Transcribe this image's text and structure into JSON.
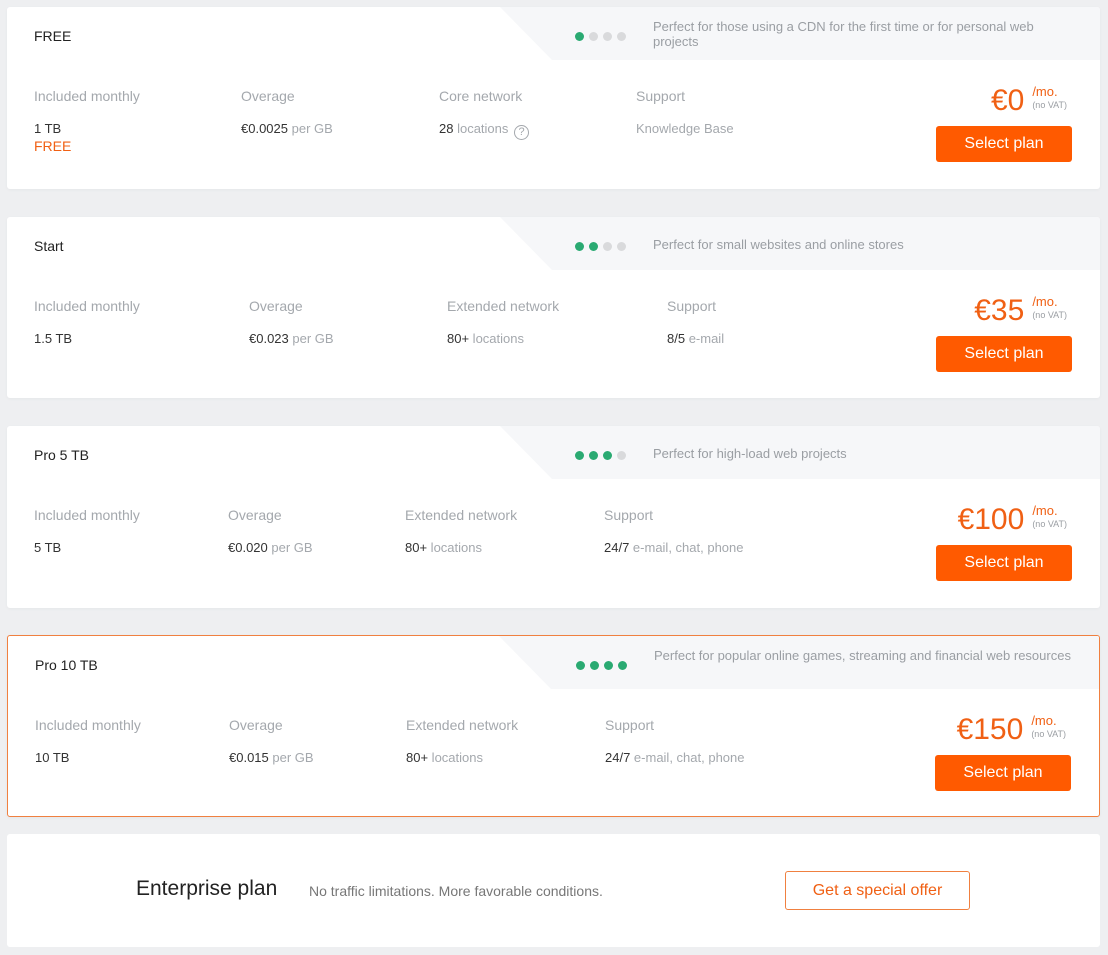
{
  "plans": [
    {
      "name": "FREE",
      "rating": 1,
      "rating_max": 4,
      "description": "Perfect for those using a CDN for the first time or for personal web projects",
      "columns": [
        {
          "label": "Included monthly",
          "value": "1 TB",
          "suffix": "",
          "extra": "FREE"
        },
        {
          "label": "Overage",
          "value": "€0.0025",
          "suffix": " per GB"
        },
        {
          "label": "Core network",
          "value": "28",
          "suffix": " locations",
          "help": "?"
        },
        {
          "label": "Support",
          "value": "",
          "suffix": "Knowledge Base"
        }
      ],
      "price": "€0",
      "per": "/mo.",
      "vat": "(no VAT)",
      "button": "Select plan",
      "highlighted": false
    },
    {
      "name": "Start",
      "rating": 2,
      "rating_max": 4,
      "description": "Perfect for small websites and online stores",
      "columns": [
        {
          "label": "Included monthly",
          "value": "1.5 TB",
          "suffix": ""
        },
        {
          "label": "Overage",
          "value": "€0.023",
          "suffix": " per GB"
        },
        {
          "label": "Extended network",
          "value": "80+",
          "suffix": " locations"
        },
        {
          "label": "Support",
          "value": "8/5",
          "suffix": " e-mail"
        }
      ],
      "price": "€35",
      "per": "/mo.",
      "vat": "(no VAT)",
      "button": "Select plan",
      "highlighted": false
    },
    {
      "name": "Pro 5 TB",
      "rating": 3,
      "rating_max": 4,
      "description": "Perfect for high-load web projects",
      "columns": [
        {
          "label": "Included monthly",
          "value": "5 TB",
          "suffix": ""
        },
        {
          "label": "Overage",
          "value": "€0.020",
          "suffix": " per GB"
        },
        {
          "label": "Extended network",
          "value": "80+",
          "suffix": " locations"
        },
        {
          "label": "Support",
          "value": "24/7",
          "suffix": " e-mail, chat, phone"
        }
      ],
      "price": "€100",
      "per": "/mo.",
      "vat": "(no VAT)",
      "button": "Select plan",
      "highlighted": false
    },
    {
      "name": "Pro 10 TB",
      "rating": 4,
      "rating_max": 4,
      "description": "Perfect for popular online games, streaming and financial web resources",
      "columns": [
        {
          "label": "Included monthly",
          "value": "10 TB",
          "suffix": ""
        },
        {
          "label": "Overage",
          "value": "€0.015",
          "suffix": " per GB"
        },
        {
          "label": "Extended network",
          "value": "80+",
          "suffix": " locations"
        },
        {
          "label": "Support",
          "value": "24/7",
          "suffix": " e-mail, chat, phone"
        }
      ],
      "price": "€150",
      "per": "/mo.",
      "vat": "(no VAT)",
      "button": "Select plan",
      "highlighted": true
    }
  ],
  "enterprise": {
    "title": "Enterprise plan",
    "description": "No traffic limitations. More favorable conditions.",
    "button": "Get a special offer"
  },
  "colors": {
    "accent": "#ff5a00",
    "rating_on": "#2aaa72",
    "rating_off": "#d9dadc"
  }
}
